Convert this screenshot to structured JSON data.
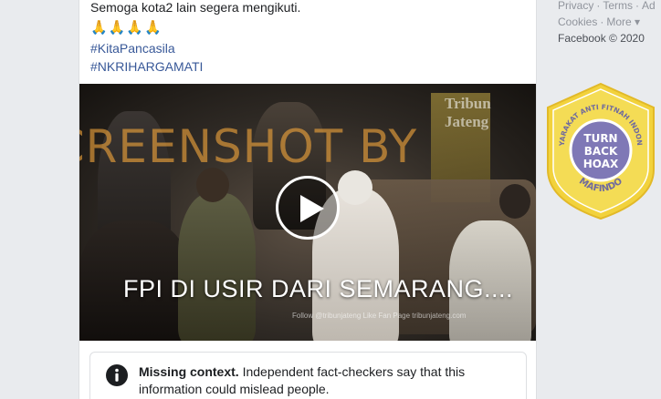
{
  "post": {
    "text_line": "Semoga kota2 lain segera mengikuti.",
    "emoji": "🙏🙏🙏🙏",
    "hashtags": [
      "#KitaPancasila",
      "#NKRIHARGAMATI"
    ]
  },
  "video": {
    "watermark": "SCREENSHOT BY",
    "channel_logo": "Tribun Jateng",
    "caption": "FPI DI USIR DARI SEMARANG....",
    "credits": "Follow @tribunjateng    Like Fan Page    tribunjateng.com",
    "play_icon": "play-icon"
  },
  "fact_check": {
    "title": "Missing context.",
    "body": " Independent fact-checkers say that this information could mislead people.",
    "icon": "info-icon"
  },
  "sidebar": {
    "row1": [
      "Privacy",
      "Terms",
      "Ad"
    ],
    "row2": [
      "Cookies",
      "More"
    ],
    "more_suffix": "▾",
    "separator": "·",
    "copyright": "Facebook © 2020"
  },
  "badge": {
    "arc_text": "MASYARAKAT ANTI FITNAH INDONESIA",
    "center_lines": [
      "TURN",
      "BACK",
      "HOAX"
    ],
    "bottom_text": "MAFINDO",
    "colors": {
      "gold": "#f2d23c",
      "purple": "#7f78b6",
      "outline": "#e8c23a"
    }
  }
}
